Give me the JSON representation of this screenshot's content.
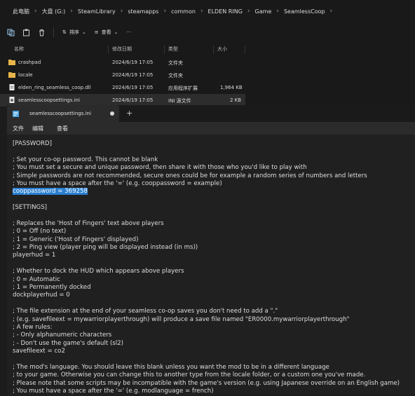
{
  "explorer": {
    "breadcrumb": [
      "此电脑",
      "大盘 (G:)",
      "SteamLibrary",
      "steamapps",
      "common",
      "ELDEN RING",
      "Game",
      "SeamlessCoop"
    ],
    "toolbar": {
      "sort_label": "排序",
      "view_label": "查看"
    },
    "columns": {
      "name": "名称",
      "modified": "修改日期",
      "type": "类型",
      "size": "大小"
    },
    "files": [
      {
        "name": "crashpad",
        "modified": "2024/6/19 17:05",
        "type": "文件夹",
        "size": "",
        "icon": "folder-icon"
      },
      {
        "name": "locale",
        "modified": "2024/6/19 17:05",
        "type": "文件夹",
        "size": "",
        "icon": "folder-icon"
      },
      {
        "name": "elden_ring_seamless_coop.dll",
        "modified": "2024/6/19 17:05",
        "type": "应用程序扩展",
        "size": "1,964 KB",
        "icon": "dll-file-icon"
      },
      {
        "name": "seamlesscoopsettings.ini",
        "modified": "2024/6/19 17:05",
        "type": "INI 源文件",
        "size": "2 KB",
        "icon": "ini-file-icon",
        "selected": true
      }
    ]
  },
  "notepad": {
    "tab_title": "seamlesscoopsettings.ini",
    "new_tab": "+",
    "menu": {
      "file": "文件",
      "edit": "编辑",
      "view": "查看"
    },
    "lines": [
      "[PASSWORD]",
      "",
      "; Set your co-op password. This cannot be blank",
      "; You must set a secure and unique password, then share it with those who you'd like to play with",
      "; Simple passwords are not recommended, secure ones could be for example a random series of numbers and letters",
      "; You must have a space after the '=' (e.g. cooppassword = example)",
      "cooppassword = 369258",
      "",
      "[SETTINGS]",
      "",
      "; Replaces the 'Host of Fingers' text above players",
      "; 0 = Off (no text)",
      "; 1 = Generic ('Host of Fingers' displayed)",
      "; 2 = Ping view (player ping will be displayed instead (in ms))",
      "playerhud = 1",
      "",
      "; Whether to dock the HUD which appears above players",
      "; 0 = Automatic",
      "; 1 = Permanently docked",
      "dockplayerhud = 0",
      "",
      "; The file extension at the end of your seamless co-op saves you don't need to add a \".\"",
      "; (e.g. savefileext = mywarriorplayerthrough) will produce a save file named \"ER0000.mywarriorplayerthrough\"",
      "; A few rules:",
      "; - Only alphanumeric characters",
      "; - Don't use the game's default (sl2)",
      "savefileext = co2",
      "",
      "; The mod's language. You should leave this blank unless you want the mod to be in a different language",
      "; to your game. Otherwise you can change this to another type from the locale folder, or a custom one you've made.",
      "; Please note that some scripts may be incompatible with the game's version (e.g. using Japanese override on an English game)",
      "; You must have a space after the '=' (e.g. modlanguage = french)"
    ],
    "highlighted_line": 6
  },
  "colors": {
    "selection": "#2a7fd0",
    "folder": "#e8b54a",
    "background": "#202020"
  }
}
